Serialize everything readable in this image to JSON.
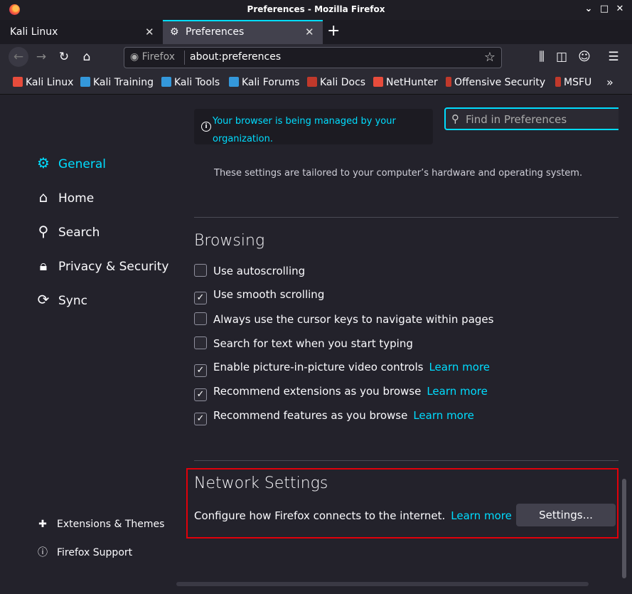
{
  "window": {
    "title": "Preferences - Mozilla Firefox",
    "controls": [
      "⌄",
      "⌃",
      "✕"
    ]
  },
  "tabs": [
    {
      "label": "Kali Linux"
    },
    {
      "label": "Preferences"
    }
  ],
  "navbar": {
    "identity": "Firefox",
    "url": "about:preferences"
  },
  "bookmarks": [
    {
      "label": "Kali Linux",
      "color": "#e74c3c"
    },
    {
      "label": "Kali Training",
      "color": "#3498db"
    },
    {
      "label": "Kali Tools",
      "color": "#3498db"
    },
    {
      "label": "Kali Forums",
      "color": "#3498db"
    },
    {
      "label": "Kali Docs",
      "color": "#c0392b"
    },
    {
      "label": "NetHunter",
      "color": "#e74c3c"
    },
    {
      "label": "Offensive Security",
      "color": "#c0392b"
    },
    {
      "label": "MSFU",
      "color": "#c0392b"
    }
  ],
  "sidebar": {
    "categories": [
      {
        "label": "General",
        "icon": "gear-icon",
        "selected": true
      },
      {
        "label": "Home",
        "icon": "home-icon"
      },
      {
        "label": "Search",
        "icon": "search-icon"
      },
      {
        "label": "Privacy & Security",
        "icon": "lock-icon"
      },
      {
        "label": "Sync",
        "icon": "sync-icon"
      }
    ],
    "footer": [
      {
        "label": "Extensions & Themes",
        "icon": "puzzle-icon"
      },
      {
        "label": "Firefox Support",
        "icon": "help-icon"
      }
    ]
  },
  "policy_notice": "Your browser is being managed by your organization.",
  "search": {
    "placeholder": "Find in Preferences"
  },
  "performance_note": "These settings are tailored to your computer’s hardware and operating system.",
  "browsing": {
    "heading": "Browsing",
    "options": [
      {
        "label": "Use autoscrolling",
        "checked": false,
        "link": ""
      },
      {
        "label": "Use smooth scrolling",
        "checked": true,
        "link": ""
      },
      {
        "label": "Always use the cursor keys to navigate within pages",
        "checked": false,
        "link": ""
      },
      {
        "label": "Search for text when you start typing",
        "checked": false,
        "link": ""
      },
      {
        "label": "Enable picture-in-picture video controls",
        "checked": true,
        "link": "Learn more"
      },
      {
        "label": "Recommend extensions as you browse",
        "checked": true,
        "link": "Learn more"
      },
      {
        "label": "Recommend features as you browse",
        "checked": true,
        "link": "Learn more"
      }
    ]
  },
  "network": {
    "heading": "Network Settings",
    "description": "Configure how Firefox connects to the internet.",
    "link": "Learn more",
    "button": "Settings..."
  },
  "colors": {
    "accent": "#00ddff",
    "highlight": "#e1000a"
  }
}
